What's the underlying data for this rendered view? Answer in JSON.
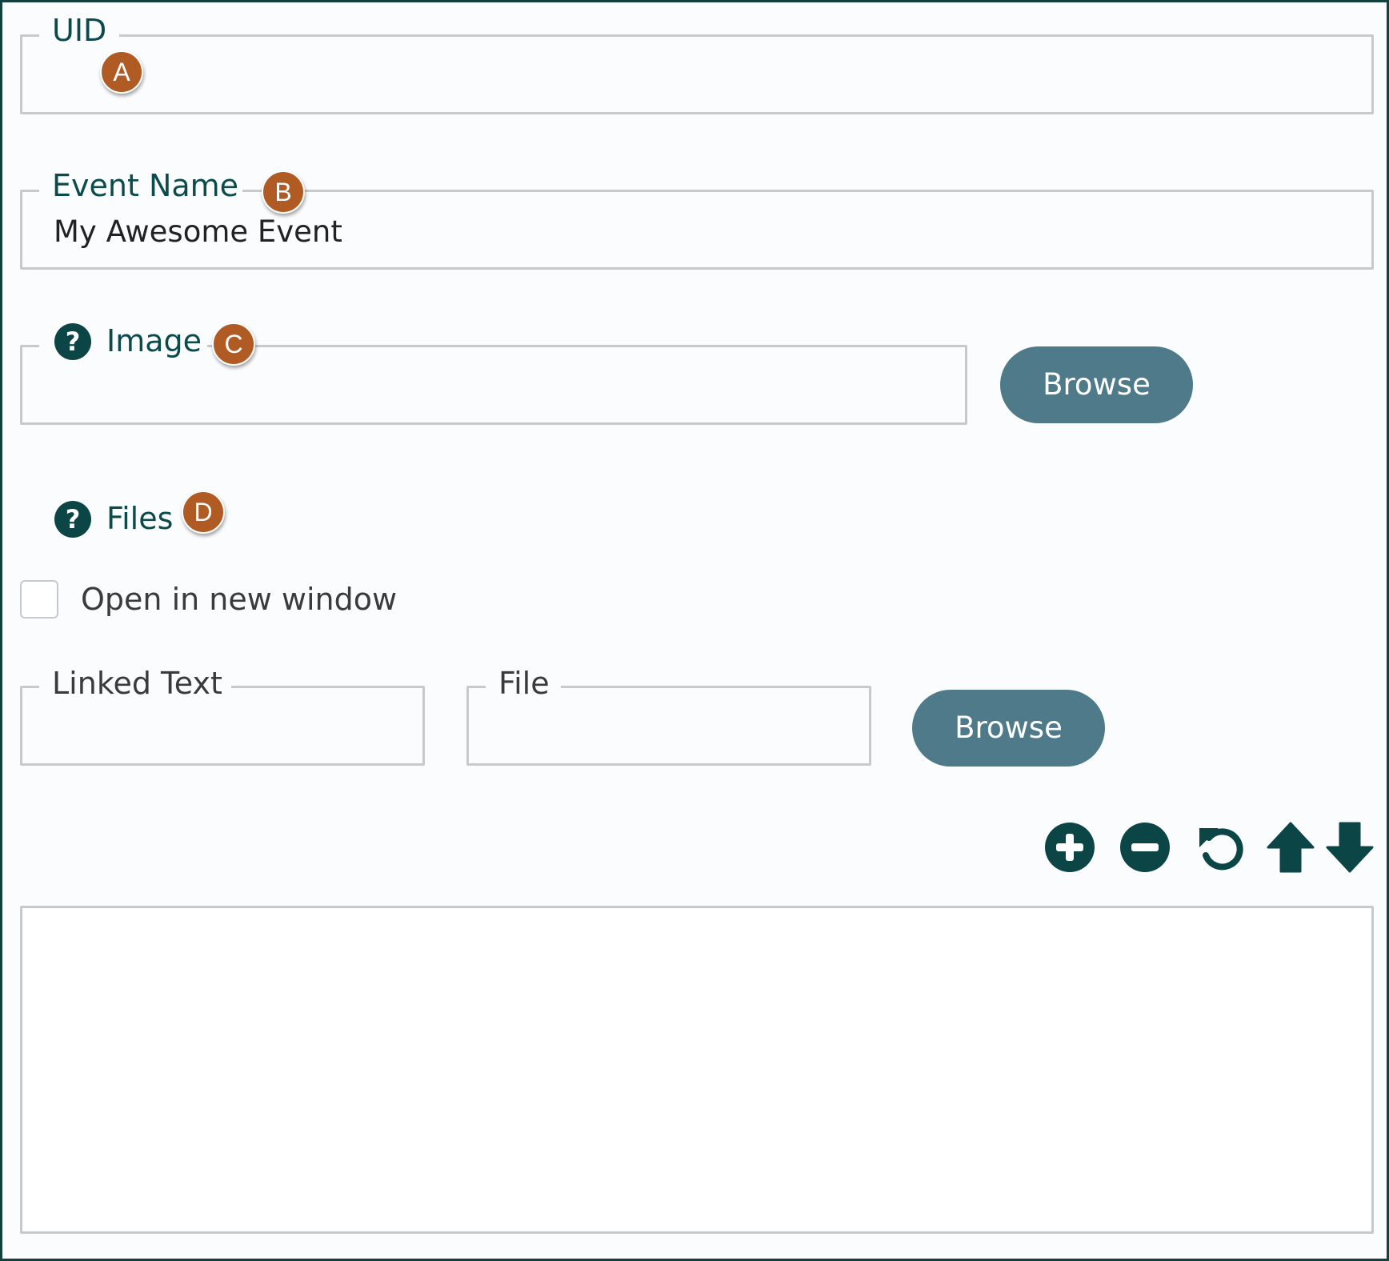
{
  "uid": {
    "label": "UID",
    "value": "",
    "callout": "A"
  },
  "event_name": {
    "label": "Event Name",
    "value": "My Awesome Event",
    "callout": "B"
  },
  "image": {
    "label": "Image",
    "value": "",
    "callout": "C",
    "browse_label": "Browse"
  },
  "files": {
    "label": "Files",
    "callout": "D",
    "open_new_window_label": "Open in new window",
    "open_new_window_checked": false,
    "linked_text": {
      "label": "Linked Text",
      "value": ""
    },
    "file": {
      "label": "File",
      "value": "",
      "browse_label": "Browse"
    },
    "toolbar": [
      "plus-circle-icon",
      "minus-circle-icon",
      "undo-icon",
      "arrow-up-icon",
      "arrow-down-icon"
    ],
    "list_items": []
  },
  "colors": {
    "label_teal": "#0d4a4b",
    "callout": "#b05a24",
    "button": "#4e7a89",
    "icon": "#0c4545",
    "field_border": "#c9c9c9"
  }
}
